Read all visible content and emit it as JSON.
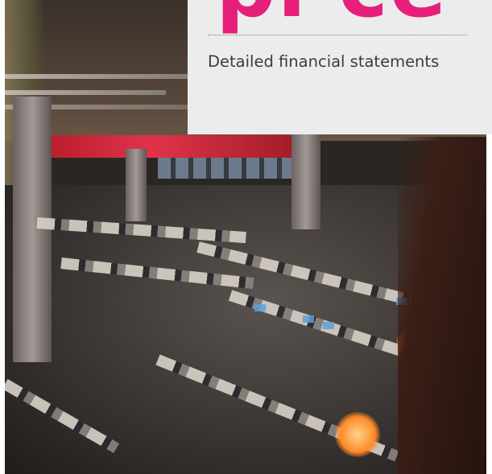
{
  "section": {
    "heading": "pi ce",
    "subtitle": "Detailed financial statements"
  },
  "colors": {
    "accent": "#e61f7a",
    "card_background": "#ececec",
    "text": "#3c3c3c"
  }
}
